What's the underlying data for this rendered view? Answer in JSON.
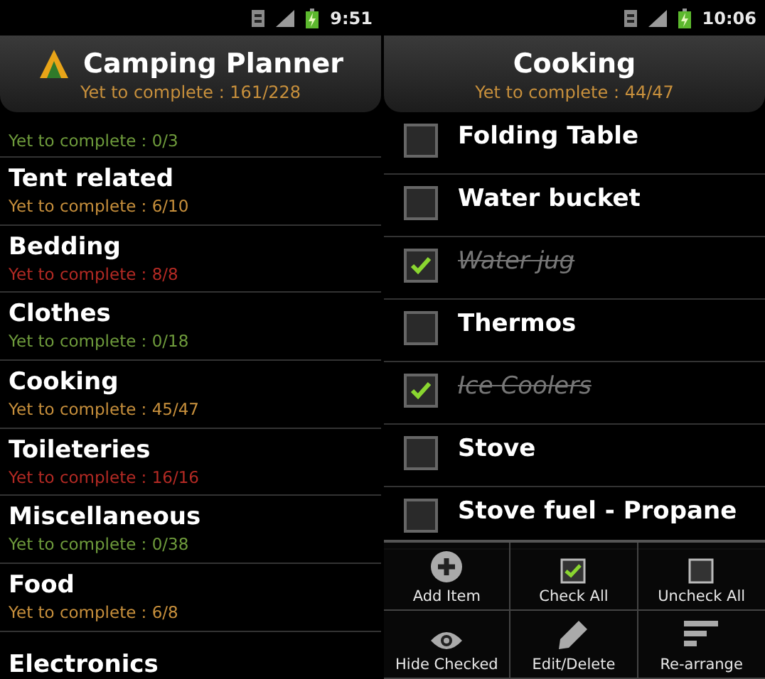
{
  "screens": [
    {
      "status_bar": {
        "time": "9:51"
      },
      "header": {
        "title": "Camping Planner",
        "subtitle": "Yet to complete : 161/228",
        "app_icon": true
      },
      "categories": [
        {
          "progress": "Yet to complete : 0/3",
          "color": "#6f9c3c"
        },
        {
          "name": "Tent related",
          "progress": "Yet to complete : 6/10",
          "color": "#c8903c"
        },
        {
          "name": "Bedding",
          "progress": "Yet to complete : 8/8",
          "color": "#b42a24"
        },
        {
          "name": "Clothes",
          "progress": "Yet to complete : 0/18",
          "color": "#6f9c3c"
        },
        {
          "name": "Cooking",
          "progress": "Yet to complete : 45/47",
          "color": "#c8903c"
        },
        {
          "name": "Toileteries",
          "progress": "Yet to complete : 16/16",
          "color": "#b42a24"
        },
        {
          "name": "Miscellaneous",
          "progress": "Yet to complete : 0/38",
          "color": "#6f9c3c"
        },
        {
          "name": "Food",
          "progress": "Yet to complete : 6/8",
          "color": "#c8903c"
        },
        {
          "name": "Electronics"
        }
      ]
    },
    {
      "status_bar": {
        "time": "10:06"
      },
      "header": {
        "title": "Cooking",
        "subtitle": "Yet to complete : 44/47",
        "app_icon": false
      },
      "items": [
        {
          "name": "Folding Table",
          "checked": false
        },
        {
          "name": "Water bucket",
          "checked": false
        },
        {
          "name": "Water jug",
          "checked": true
        },
        {
          "name": "Thermos",
          "checked": false
        },
        {
          "name": "Ice Coolers",
          "checked": true
        },
        {
          "name": "Stove",
          "checked": false
        },
        {
          "name": "Stove fuel - Propane",
          "checked": false
        }
      ],
      "menu": [
        {
          "kind": "add",
          "label": "Add Item"
        },
        {
          "kind": "check",
          "label": "Check All"
        },
        {
          "kind": "uncheck",
          "label": "Uncheck All"
        },
        {
          "kind": "hide",
          "label": "Hide Checked"
        },
        {
          "kind": "edit",
          "label": "Edit/Delete"
        },
        {
          "kind": "arrange",
          "label": "Re-arrange"
        }
      ]
    }
  ]
}
